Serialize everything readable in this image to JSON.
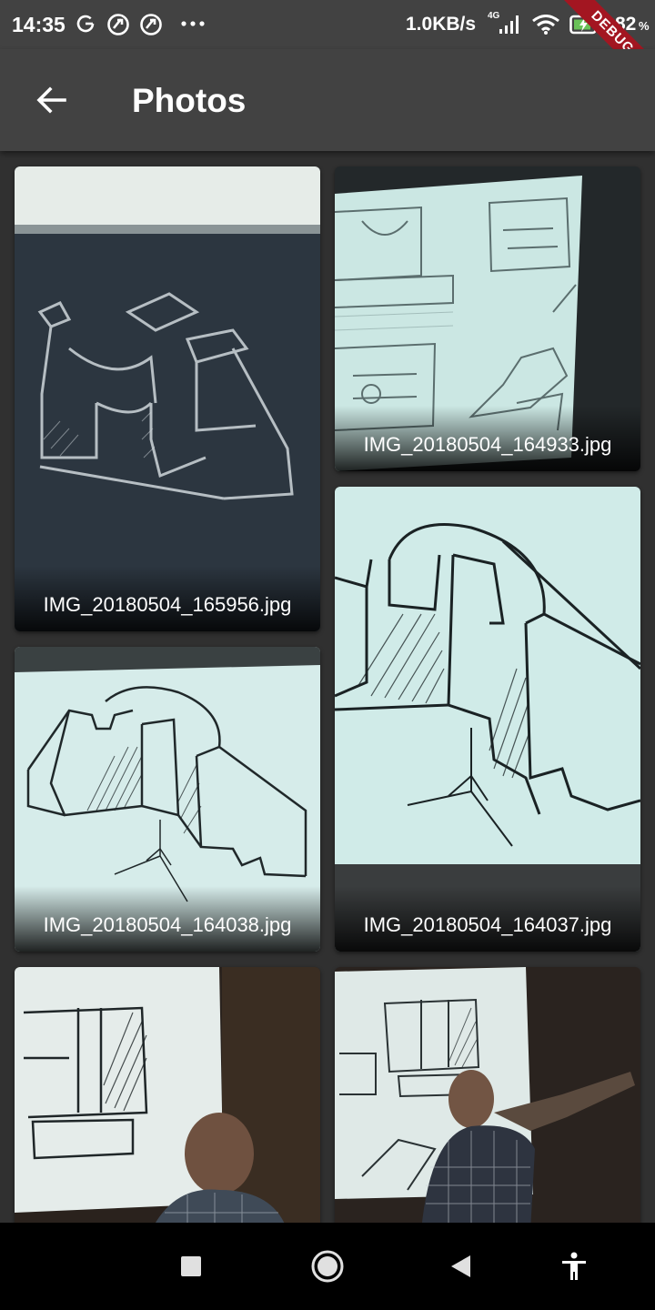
{
  "status_bar": {
    "time": "14:35",
    "net_speed": "1.0KB/s",
    "network_type": "4G",
    "battery": "82",
    "battery_unit": "%",
    "debug_label": "DEBUG",
    "left_icons": [
      "g-icon",
      "at-icon",
      "at-icon",
      "more-dots-icon"
    ],
    "right_icons": [
      "signal-icon",
      "wifi-icon",
      "battery-charging-icon"
    ]
  },
  "app_bar": {
    "title": "Photos",
    "back_icon": "arrow-back-icon"
  },
  "photos": [
    {
      "caption": "IMG_20180504_165956.jpg",
      "subject": "chalkboard-sketch"
    },
    {
      "caption": "IMG_20180504_164933.jpg",
      "subject": "projected-drawing-views"
    },
    {
      "caption": "IMG_20180504_164038.jpg",
      "subject": "isometric-section-drawing"
    },
    {
      "caption": "IMG_20180504_164037.jpg",
      "subject": "isometric-section-drawing-closeup"
    },
    {
      "caption": "",
      "subject": "lecturer-with-projection"
    },
    {
      "caption": "",
      "subject": "lecturer-pointing-at-projection"
    }
  ],
  "nav_bar": {
    "icons": [
      "recents-square-icon",
      "home-circle-icon",
      "back-triangle-icon",
      "accessibility-icon"
    ]
  },
  "colors": {
    "background": "#303030",
    "app_bar": "#424242",
    "status_bar": "#424242",
    "debug_banner": "#a31621",
    "nav_bar": "#000000"
  }
}
